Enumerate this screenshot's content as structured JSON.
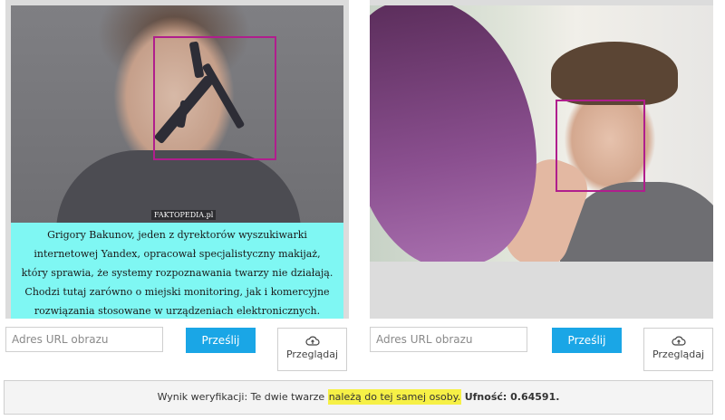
{
  "left_panel": {
    "watermark": "FAKTOPEDIA.pl",
    "caption_lines": [
      "Grigory Bakunov, jeden z dyrektorów wyszukiwarki",
      "internetowej Yandex, opracował specjalistyczny makijaż,",
      "który sprawia, że systemy rozpoznawania twarzy nie działają.",
      "Chodzi tutaj zarówno o miejski monitoring, jak i komercyjne",
      "rozwiązania stosowane w urządzeniach elektronicznych."
    ]
  },
  "controls": {
    "url_placeholder": "Adres URL obrazu",
    "send_label": "Prześlij",
    "browse_label": "Przeglądaj",
    "browse_icon": "cloud-upload-icon"
  },
  "result": {
    "prefix": "Wynik weryfikacji: Te dwie twarze ",
    "highlight": "należą do tej samej osoby.",
    "confidence_label": "Ufność: 0.64591."
  },
  "colors": {
    "face_box": "#b01e8d",
    "send_button": "#1aa6e6",
    "caption_bg": "#7ff7f3",
    "highlight": "#f6f046"
  }
}
